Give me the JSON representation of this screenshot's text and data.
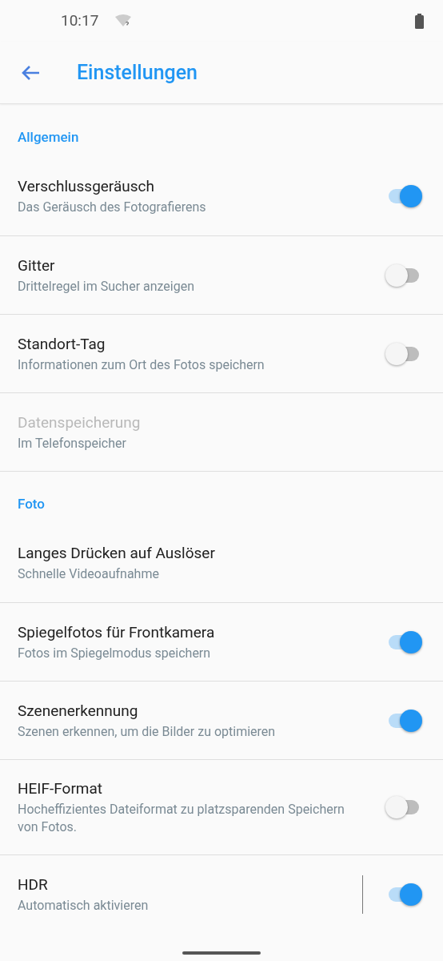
{
  "status_bar": {
    "time": "10:17"
  },
  "app_bar": {
    "title": "Einstellungen"
  },
  "sections": [
    {
      "title": "Allgemein",
      "items": [
        {
          "kind": "switch",
          "title": "Verschlussgeräusch",
          "subtitle": "Das Geräusch des Fotografierens",
          "on": true,
          "disabled": false
        },
        {
          "kind": "switch",
          "title": "Gitter",
          "subtitle": "Drittelregel im Sucher anzeigen",
          "on": false,
          "disabled": false
        },
        {
          "kind": "switch",
          "title": "Standort-Tag",
          "subtitle": "Informationen zum Ort des Fotos speichern",
          "on": false,
          "disabled": false
        },
        {
          "kind": "plain",
          "title": "Datenspeicherung",
          "subtitle": "Im Telefonspeicher",
          "disabled": true
        }
      ]
    },
    {
      "title": "Foto",
      "items": [
        {
          "kind": "plain",
          "title": "Langes Drücken auf Auslöser",
          "subtitle": "Schnelle Videoaufnahme",
          "disabled": false
        },
        {
          "kind": "switch",
          "title": "Spiegelfotos für Frontkamera",
          "subtitle": "Fotos im Spiegelmodus speichern",
          "on": true,
          "disabled": false
        },
        {
          "kind": "switch",
          "title": "Szenenerkennung",
          "subtitle": "Szenen erkennen, um die Bilder zu optimieren",
          "on": true,
          "disabled": false
        },
        {
          "kind": "switch",
          "title": "HEIF-Format",
          "subtitle": "Hocheffizientes Dateiformat zu platzsparenden Speichern von Fotos.",
          "on": false,
          "disabled": false
        },
        {
          "kind": "switch_divided",
          "title": "HDR",
          "subtitle": "Automatisch aktivieren",
          "on": true,
          "disabled": false
        }
      ]
    }
  ]
}
